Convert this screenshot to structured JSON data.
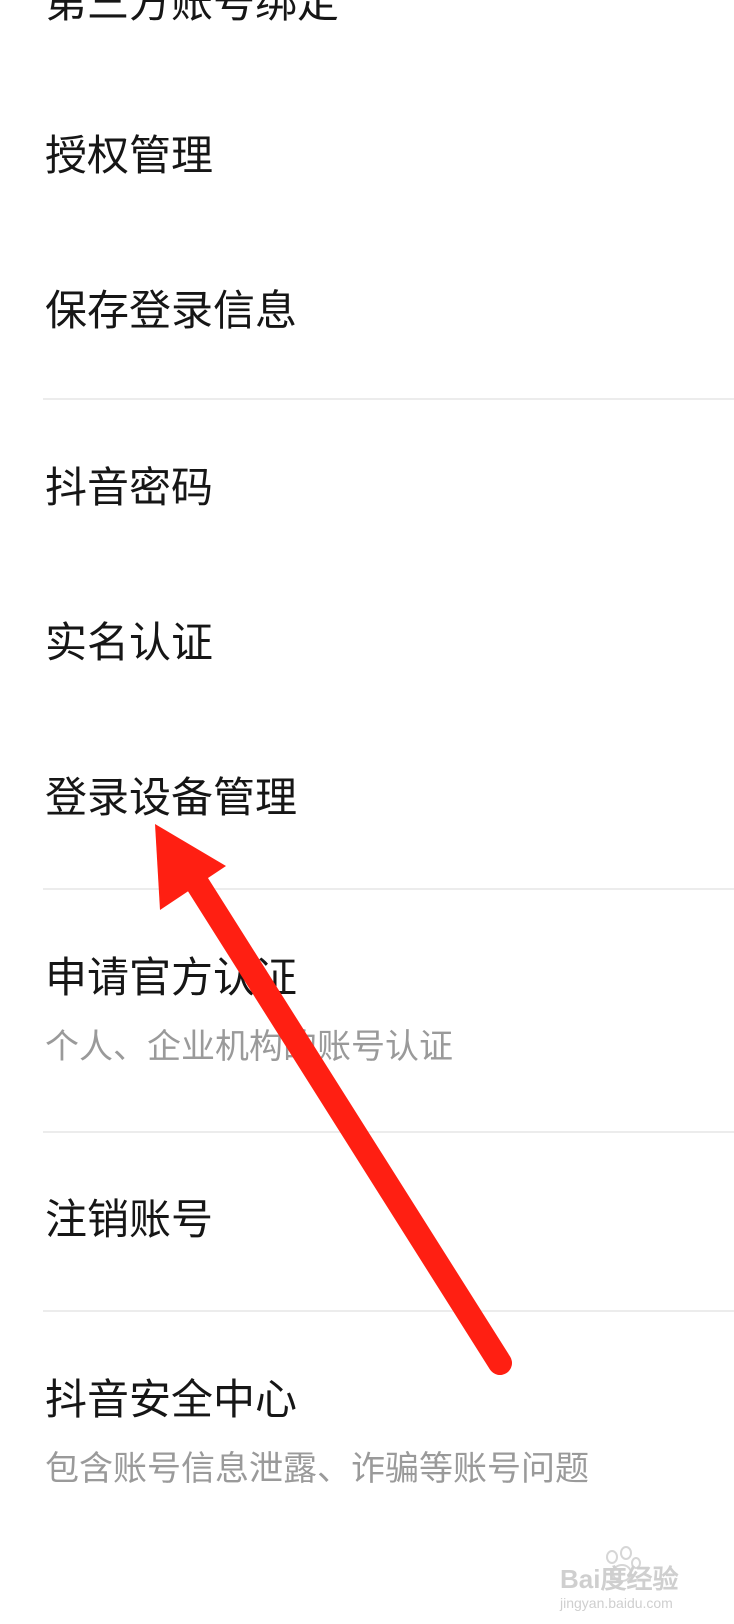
{
  "settings_list": {
    "items": [
      {
        "title": "第三方账号绑定"
      },
      {
        "title": "授权管理"
      },
      {
        "title": "保存登录信息"
      },
      {
        "title": "抖音密码"
      },
      {
        "title": "实名认证"
      },
      {
        "title": "登录设备管理"
      },
      {
        "title": "申请官方认证",
        "subtitle": "个人、企业机构的账号认证"
      },
      {
        "title": "注销账号"
      },
      {
        "title": "抖音安全中心",
        "subtitle": "包含账号信息泄露、诈骗等账号问题"
      }
    ]
  },
  "annotation": {
    "arrow_color": "#ff1f12",
    "points_to": "登录设备管理"
  },
  "watermark": {
    "brand": "Bai度经验",
    "url": "jingyan.baidu.com"
  }
}
